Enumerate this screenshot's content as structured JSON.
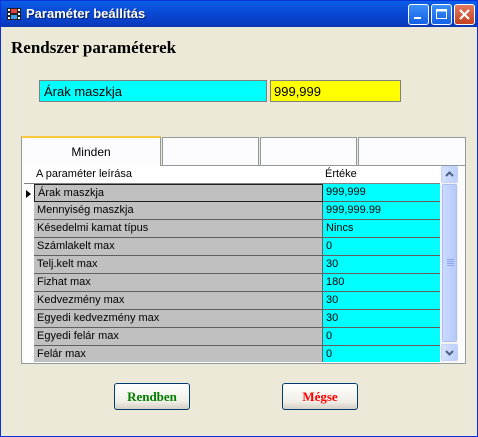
{
  "window": {
    "title": "Paraméter beállítás",
    "icon": "film-app-icon"
  },
  "heading": "Rendszer paraméterek",
  "editor": {
    "name": "Árak maszkja",
    "value": "999,999",
    "name_bg": "#00ffff",
    "value_bg": "#ffff00"
  },
  "tabs": [
    {
      "label": "Minden",
      "active": true
    },
    {
      "label": "",
      "active": false
    },
    {
      "label": "",
      "active": false
    },
    {
      "label": "",
      "active": false
    }
  ],
  "grid": {
    "col_name": "A paraméter leírása",
    "col_value": "Értéke",
    "rows": [
      {
        "name": "Árak maszkja",
        "value": "999,999"
      },
      {
        "name": "Mennyiség maszkja",
        "value": "999,999.99"
      },
      {
        "name": "Késedelmi kamat típus",
        "value": "Nincs"
      },
      {
        "name": "Számlakelt max",
        "value": "0"
      },
      {
        "name": "Telj.kelt max",
        "value": "30"
      },
      {
        "name": "Fizhat max",
        "value": "180"
      },
      {
        "name": "Kedvezmény max",
        "value": "30"
      },
      {
        "name": "Egyedi kedvezmény max",
        "value": "30"
      },
      {
        "name": "Egyedi felár max",
        "value": "0"
      },
      {
        "name": "Felár max",
        "value": "0"
      }
    ]
  },
  "buttons": {
    "ok": "Rendben",
    "cancel": "Mégse"
  },
  "colors": {
    "title_bar": "#0a5fe8",
    "ok_text": "#008000",
    "cancel_text": "#ff0000",
    "row_name_bg": "#c0c0c0",
    "row_value_bg": "#00ffff"
  }
}
